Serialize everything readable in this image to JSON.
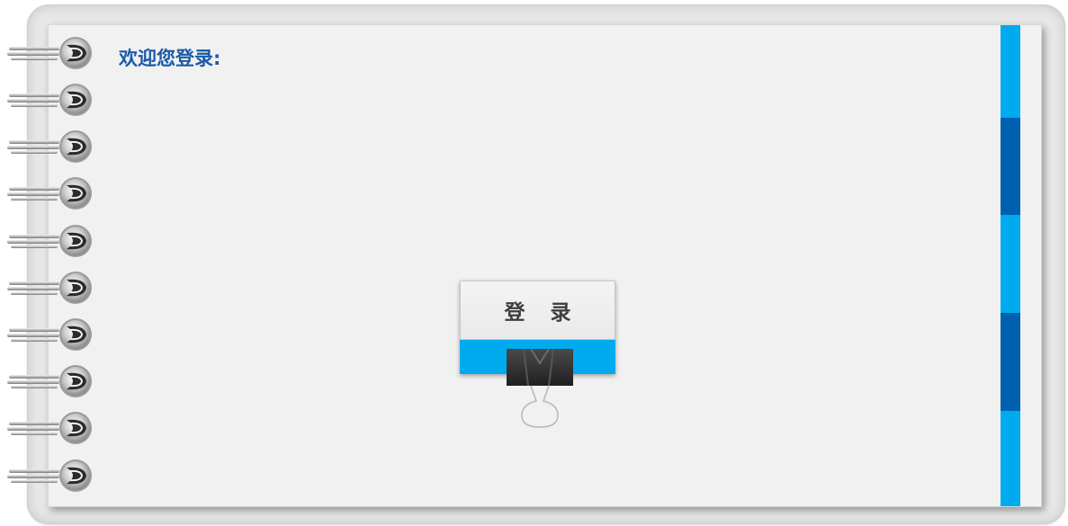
{
  "page": {
    "title": "欢迎您登录:"
  },
  "login": {
    "button_label": "登 录"
  },
  "colors": {
    "accent_light": "#00aaee",
    "accent_dark": "#0060b0",
    "title_blue": "#1b5aa8",
    "page_background": "#f1f1f1"
  },
  "decor": {
    "binding": "spiral-ring-icon",
    "clip": "binder-clip-icon"
  }
}
